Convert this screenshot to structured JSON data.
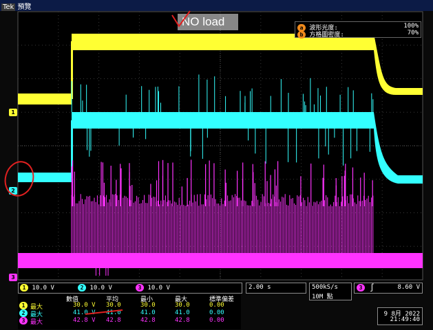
{
  "header": {
    "mode_tag": "Tek",
    "mode_label": "預覽",
    "overlay_note": "NO load"
  },
  "display_info": [
    {
      "badge": "a",
      "label": "波形光度:",
      "value": "100%"
    },
    {
      "badge": "b",
      "label": "方格圖密度:",
      "value": "70%"
    }
  ],
  "channels": [
    {
      "id": "1",
      "marker": "1",
      "scale": "10.0 V",
      "color": "#ffff33"
    },
    {
      "id": "2",
      "marker": "2",
      "scale": "10.0 V",
      "color": "#33ffff"
    },
    {
      "id": "3",
      "marker": "3",
      "scale": "10.0 V",
      "color": "#ff33ff"
    }
  ],
  "timebase": "2.00 s",
  "acquisition": {
    "rate": "500kS/s",
    "points": "10M 點"
  },
  "trigger": {
    "source": "3",
    "slope": "rising",
    "slope_glyph": "∫",
    "level": "8.60 V"
  },
  "measurements": {
    "headers": [
      "數值",
      "平均",
      "最小",
      "最大",
      "標準偏差"
    ],
    "rows": [
      {
        "ch": "1",
        "name": "最大",
        "values": [
          "30.0 V",
          "30.0",
          "30.0",
          "30.0",
          "0.00"
        ]
      },
      {
        "ch": "2",
        "name": "最大",
        "values": [
          "41.0 V",
          "41.0",
          "41.0",
          "41.0",
          "0.00"
        ]
      },
      {
        "ch": "3",
        "name": "最大",
        "values": [
          "42.8 V",
          "42.8",
          "42.8",
          "42.8",
          "0.00"
        ]
      }
    ]
  },
  "datetime": {
    "date": "9 8月 2022",
    "time": "21:49:40"
  }
}
